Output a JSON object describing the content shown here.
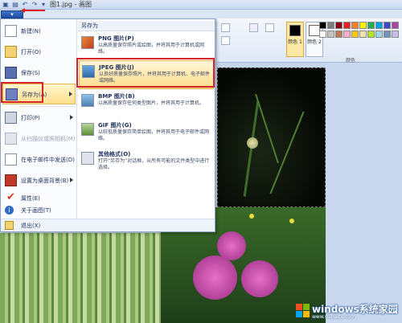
{
  "titlebar": {
    "title": "图1.jpg - 画图",
    "app_button_label": "▾"
  },
  "menu": {
    "items": [
      {
        "label": "新建(N)",
        "icon": "new-file-icon"
      },
      {
        "label": "打开(O)",
        "icon": "open-folder-icon"
      },
      {
        "label": "保存(S)",
        "icon": "save-disk-icon"
      },
      {
        "label": "另存为(A)",
        "icon": "save-as-icon"
      },
      {
        "label": "打印(P)",
        "icon": "printer-icon"
      },
      {
        "label": "从扫描仪或照相机(M)",
        "icon": "scanner-icon"
      },
      {
        "label": "在电子邮件中发送(D)",
        "icon": "email-icon"
      },
      {
        "label": "设置为桌面背景(B)",
        "icon": "desktop-icon"
      },
      {
        "label": "属性(E)",
        "icon": "checkmark-icon"
      },
      {
        "label": "关于画图(T)",
        "icon": "info-icon"
      },
      {
        "label": "退出(X)",
        "icon": "exit-icon"
      }
    ]
  },
  "submenu": {
    "header": "另存为",
    "items": [
      {
        "name": "PNG 图片(P)",
        "desc": "以高质量保存照片或绘图，并将其用于计算机或网络。"
      },
      {
        "name": "JPEG 图片(J)",
        "desc": "以良好质量保存照片，并将其用于计算机、电子邮件或网络。"
      },
      {
        "name": "BMP 图片(B)",
        "desc": "以高质量保存任何类型图片，并将其用于计算机。"
      },
      {
        "name": "GIF 图片(G)",
        "desc": "以较低质量保存简单绘图，并将其用于电子邮件或网络。"
      },
      {
        "name": "其他格式(O)",
        "desc": "打开“另存为”对话框，从所有可能的文件类型中进行选择。"
      }
    ]
  },
  "ribbon": {
    "color1_label": "颜色 1",
    "color2_label": "颜色 2",
    "colors_group_label": "颜色"
  },
  "palette": [
    "#000000",
    "#7f7f7f",
    "#880015",
    "#ed1c24",
    "#ff7f27",
    "#fff200",
    "#22b14c",
    "#00a2e8",
    "#3f48cc",
    "#a349a4",
    "#ffffff",
    "#c3c3c3",
    "#b97a57",
    "#ffaec9",
    "#ffc90e",
    "#efe4b0",
    "#b5e61d",
    "#99d9ea",
    "#7092be",
    "#c8bfe7"
  ],
  "watermark": {
    "brand": "windows系统家园",
    "url": "www.ruihaitu.com"
  },
  "colors": {
    "highlight_border": "#d3252b",
    "selection_fill": "#fde08e",
    "app_button": "#1d4ea6"
  }
}
